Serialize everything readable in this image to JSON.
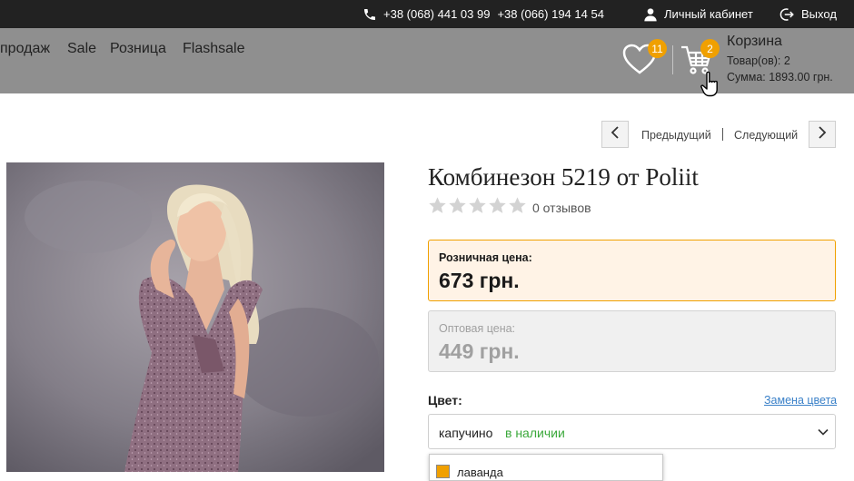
{
  "topbar": {
    "phone1": "+38 (068) 441 03 99",
    "phone2": "+38 (066) 194 14 54",
    "account": "Личный кабинет",
    "logout": "Выход"
  },
  "nav": {
    "links": [
      "продаж",
      "Sale",
      "Розница",
      "Flashsale"
    ]
  },
  "wishlist": {
    "count": "11"
  },
  "cart": {
    "count": "2",
    "title": "Корзина",
    "items": "Товар(ов): 2",
    "total": "Сумма: 1893.00 грн."
  },
  "pager": {
    "prev": "Предыдущий",
    "next": "Следующий"
  },
  "product": {
    "title": "Комбинезон 5219 от Poliit",
    "rating": 0,
    "reviews": "0 отзывов",
    "retail_label": "Розничная цена:",
    "retail_price": "673 грн.",
    "wholesale_label": "Оптовая цена:",
    "wholesale_price": "449 грн.",
    "color_label": "Цвет:",
    "color_change": "Замена цвета",
    "selected_color": "капучино",
    "stock": "в наличии",
    "dropdown_option": "лаванда"
  },
  "colors": {
    "accent": "#f0a000",
    "nav_bg": "#8f8f8f",
    "topbar_bg": "#222222",
    "in_stock": "#3aa83a",
    "link": "#3a80c8"
  }
}
